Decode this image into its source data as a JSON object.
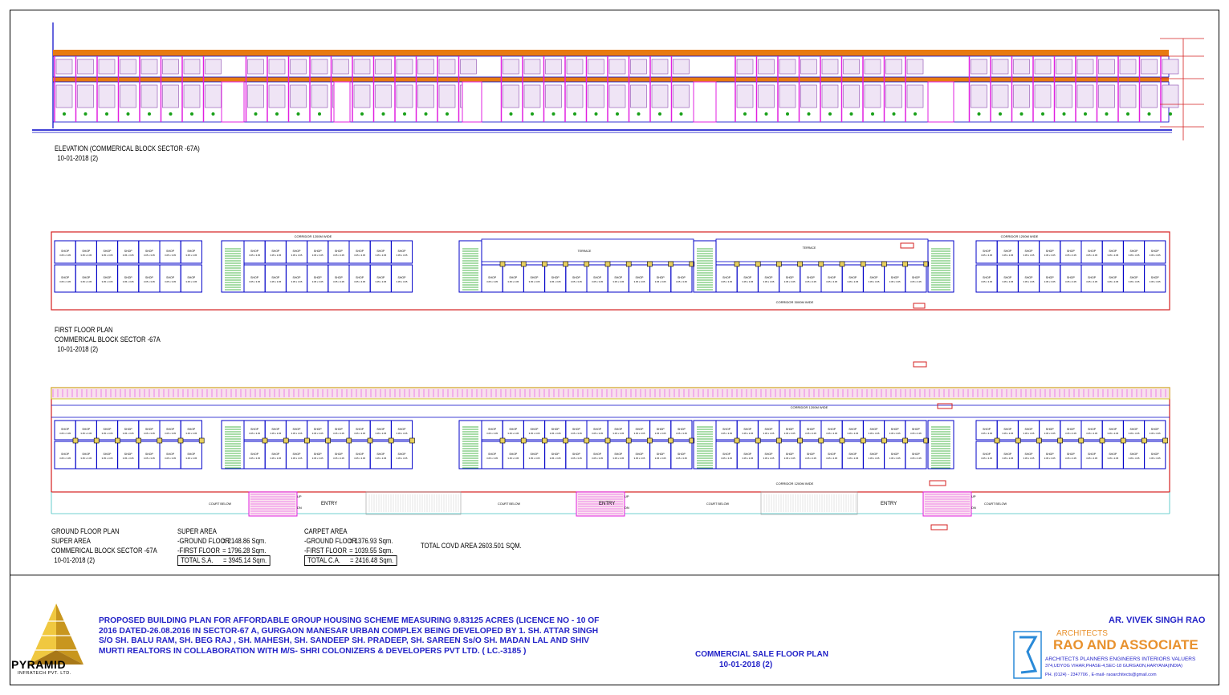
{
  "elevation": {
    "title": "ELEVATION  (COMMERICAL BLOCK SECTOR -67A)",
    "date": "10-01-2018 (2)"
  },
  "first_floor": {
    "line1": "FIRST FLOOR PLAN",
    "line2": "COMMERICAL BLOCK SECTOR -67A",
    "date": "10-01-2018 (2)",
    "corridor_top": "CORRIDOR 1200M WIDE",
    "corridor_bottom": "CORRIDOR 3000M WIDE",
    "terrace": "TERRACE",
    "electrical": "ELECTRICAL RM",
    "rest_room": "REST ROOM"
  },
  "ground_floor": {
    "line1": "GROUND FLOOR PLAN",
    "line2": "SUPER AREA",
    "line3": "COMMERICAL BLOCK SECTOR -67A",
    "date": "10-01-2018 (2)",
    "entry": "ENTRY",
    "court_below": "COURT BELOW",
    "up": "UP",
    "dn": "DN",
    "corridor": "CORRIDOR 1200M WIDE"
  },
  "super_area": {
    "heading": "SUPER AREA",
    "ground_label": "-GROUND FLOOR",
    "ground_value": "= 2148.86 Sqm.",
    "first_label": "-FIRST FLOOR",
    "first_value": "= 1796.28 Sqm.",
    "total_label": "TOTAL S.A.",
    "total_value": "= 3945.14 Sqm."
  },
  "carpet_area": {
    "heading": "CARPET AREA",
    "ground_label": "-GROUND FLOOR",
    "ground_value": "= 1376.93 Sqm.",
    "first_label": "-FIRST FLOOR",
    "first_value": "= 1039.55 Sqm.",
    "total_label": "TOTAL C.A.",
    "total_value": "= 2416.48 Sqm."
  },
  "total_covd": "TOTAL COVD AREA 2603.501 SQM.",
  "project_description": "PROPOSED BUILDING PLAN FOR AFFORDABLE GROUP HOUSING SCHEME MEASURING 9.83125 ACRES (LICENCE NO - 10  OF 2016 DATED-26.08.2016 IN SECTOR-67 A, GURGAON MANESAR URBAN COMPLEX BEING DEVELOPED BY 1. SH. ATTAR SINGH S/O SH. BALU RAM, SH. BEG RAJ , SH. MAHESH, SH.  SANDEEP SH.  PRADEEP, SH. SAREEN Ss/O SH. MADAN LAL AND SHIV MURTI REALTORS IN COLLABORATION WITH M/S- SHRI COLONIZERS  & DEVELOPERS  PVT LTD. ( LC.-3185 )",
  "sheet": {
    "title": "COMMERCIAL SALE FLOOR PLAN",
    "date": "10-01-2018 (2)"
  },
  "architect": "AR. VIVEK SINGH RAO",
  "firm": {
    "label": "ARCHITECTS",
    "name": "RAO AND ASSOCIATE",
    "services": "ARCHITECTS   PLANNERS   ENGINEERS   INTERIORS   VALUERS",
    "address": "374,UDYOG  VIHAR,PHASE-4,SEC-18  GURGAON,HARYANA(INDIA)",
    "phone": "PH.  (0124)  -  2347706  ,  E-mail-   raoarchitects@gmail.com"
  },
  "logo": {
    "name": "PYRAMID",
    "sub": "INFRATECH PVT. LTD."
  },
  "colors": {
    "outline": "#0000c8",
    "accent_red": "#d42020",
    "pink": "#e020e0",
    "orange": "#e87a10",
    "green": "#18a018",
    "blue_text": "#2323c8"
  }
}
